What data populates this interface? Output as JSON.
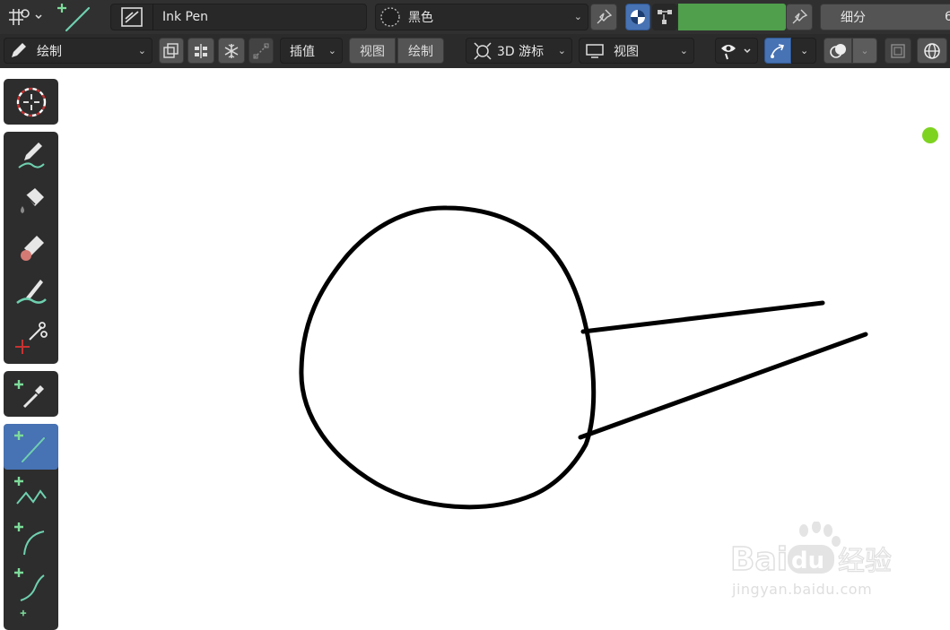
{
  "header_top": {
    "brush_name": "Ink Pen",
    "material": "黑色",
    "subdivide_label": "细分",
    "subdivide_value": "6",
    "green_color": "#4f9f4c"
  },
  "header_bottom": {
    "mode": "绘制",
    "interpolate": "插值",
    "view_menu": "视图",
    "draw_menu": "绘制",
    "cursor_label": "3D 游标",
    "orientation": "视图"
  },
  "toolbar": {
    "tools": [
      "cursor-tool",
      "draw-tool",
      "fill-tool",
      "erase-tool",
      "tint-tool",
      "cutter-tool",
      "eyedropper-tool",
      "line-tool",
      "polyline-tool",
      "arc-tool",
      "curve-tool"
    ],
    "active_tool": "line-tool"
  },
  "watermark": {
    "brand_logo_text": "Baidu经验",
    "url": "jingyan.baidu.com"
  },
  "colors": {
    "accent": "#4772b3",
    "stroke": "#000000",
    "indicator": "#7ed321",
    "panel": "#303030"
  }
}
